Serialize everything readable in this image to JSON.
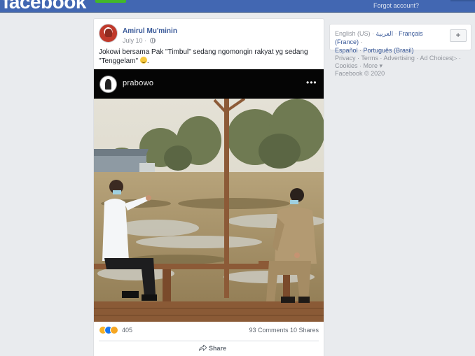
{
  "topbar": {
    "logo_text": "facebook",
    "forgot_link": "Forgot account?"
  },
  "post": {
    "author": "Amirul Mu'minin",
    "date": "July 10 ·",
    "text": "Jokowi bersama Pak \"Timbul\" sedang ngomongin rakyat yg sedang \"Tenggelam\"",
    "embedded": {
      "username": "prabowo",
      "more": "•••"
    },
    "reaction_count": "405",
    "comments_shares": "93 Comments  10 Shares",
    "share_label": "Share"
  },
  "sidebar": {
    "languages": [
      "English (US)",
      "العربية",
      "Français (France)",
      "Español",
      "Português (Brasil)"
    ],
    "plus_label": "+",
    "footer_links": [
      "Privacy",
      "Terms",
      "Advertising",
      "Ad Choices",
      "Cookies",
      "More"
    ],
    "copyright": "Facebook © 2020"
  },
  "colors": {
    "brand_blue": "#4267b2",
    "link_blue": "#385898",
    "page_bg": "#e9ebee"
  },
  "icons": {
    "audience": "globe-icon",
    "share": "share-arrow-icon",
    "ad_choices": "ad-choices-icon"
  }
}
